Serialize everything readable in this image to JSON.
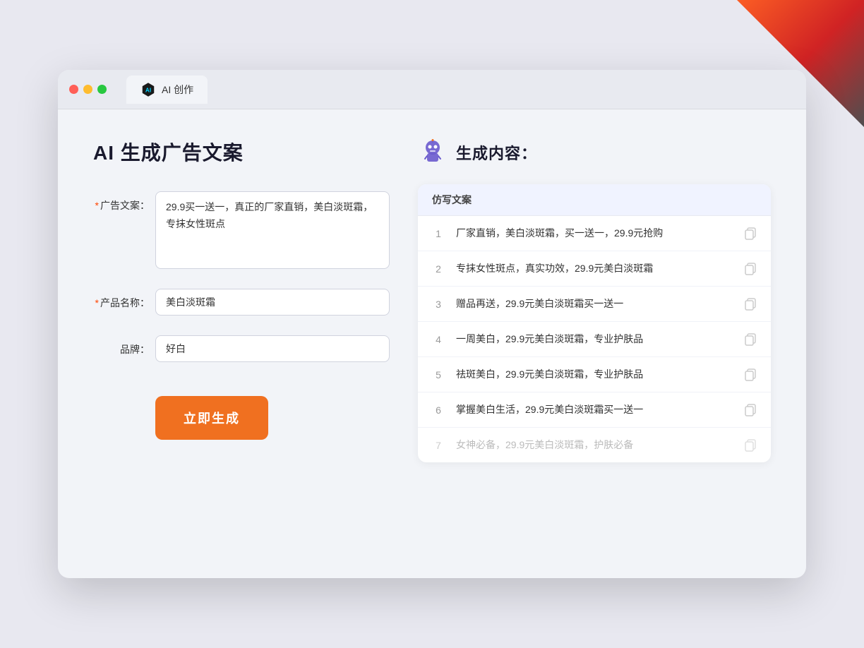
{
  "browser": {
    "tab_title": "AI 创作",
    "traffic_lights": [
      "red",
      "yellow",
      "green"
    ]
  },
  "page": {
    "title": "AI 生成广告文案",
    "form": {
      "ad_copy_label": "广告文案：",
      "ad_copy_required": "*",
      "ad_copy_value": "29.9买一送一，真正的厂家直销，美白淡斑霜，专抹女性斑点",
      "product_label": "产品名称：",
      "product_required": "*",
      "product_value": "美白淡斑霜",
      "brand_label": "品牌：",
      "brand_value": "好白",
      "generate_btn": "立即生成"
    },
    "result": {
      "header": "生成内容：",
      "table_column": "仿写文案",
      "items": [
        {
          "num": "1",
          "text": "厂家直销，美白淡斑霜，买一送一，29.9元抢购",
          "muted": false
        },
        {
          "num": "2",
          "text": "专抹女性斑点，真实功效，29.9元美白淡斑霜",
          "muted": false
        },
        {
          "num": "3",
          "text": "赠品再送，29.9元美白淡斑霜买一送一",
          "muted": false
        },
        {
          "num": "4",
          "text": "一周美白，29.9元美白淡斑霜，专业护肤品",
          "muted": false
        },
        {
          "num": "5",
          "text": "祛斑美白，29.9元美白淡斑霜，专业护肤品",
          "muted": false
        },
        {
          "num": "6",
          "text": "掌握美白生活，29.9元美白淡斑霜买一送一",
          "muted": false
        },
        {
          "num": "7",
          "text": "女神必备，29.9元美白淡斑霜，护肤必备",
          "muted": true
        }
      ]
    }
  }
}
